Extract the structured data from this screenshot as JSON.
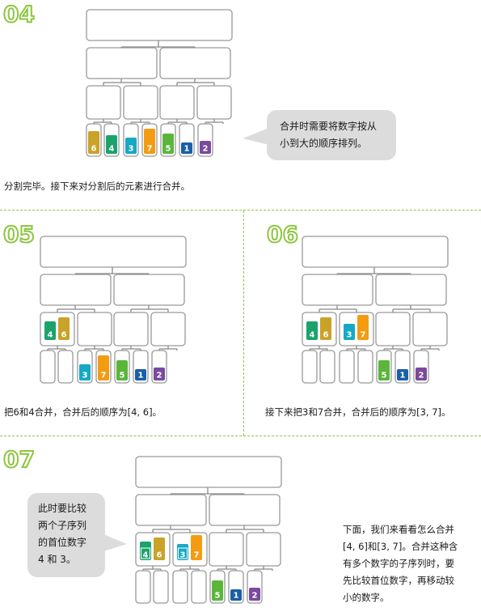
{
  "colors": {
    "accent_green": "#8dc63f",
    "box_border": "#999999",
    "connector": "#888888",
    "bubble_bg": "#dcdcdc",
    "digit_colors": {
      "1": "#1a5fa8",
      "2": "#7a4a9e",
      "3": "#16a9c4",
      "4": "#1aa36b",
      "5": "#5cb53b",
      "6": "#c9a227",
      "7": "#f39c12"
    }
  },
  "steps": [
    {
      "number": "04",
      "slots": [
        [
          "6"
        ],
        [
          "4"
        ],
        [
          "3"
        ],
        [
          "7"
        ],
        [
          "5"
        ],
        [
          "1"
        ],
        [
          "2"
        ]
      ],
      "pairs": [
        [],
        [],
        [],
        []
      ],
      "quads": [
        [],
        []
      ],
      "highlight": [],
      "bubble_lines": [
        "合并时需要将数字按从",
        "小到大的顺序排列。"
      ],
      "caption": "分割完毕。接下来对分割后的元素进行合并。"
    },
    {
      "number": "05",
      "slots": [
        [],
        [],
        [
          "3"
        ],
        [
          "7"
        ],
        [
          "5"
        ],
        [
          "1"
        ],
        [
          "2"
        ]
      ],
      "pairs": [
        [
          "4",
          "6"
        ],
        [],
        [],
        []
      ],
      "quads": [
        [],
        []
      ],
      "highlight": [],
      "caption": "把6和4合并，合并后的顺序为[4, 6]。"
    },
    {
      "number": "06",
      "slots": [
        [],
        [],
        [],
        [],
        [
          "5"
        ],
        [
          "1"
        ],
        [
          "2"
        ]
      ],
      "pairs": [
        [
          "4",
          "6"
        ],
        [
          "3",
          "7"
        ],
        [],
        []
      ],
      "quads": [
        [],
        []
      ],
      "highlight": [],
      "caption": "接下来把3和7合并，合并后的顺序为[3, 7]。"
    },
    {
      "number": "07",
      "slots": [
        [],
        [],
        [],
        [],
        [
          "5"
        ],
        [
          "1"
        ],
        [
          "2"
        ]
      ],
      "pairs": [
        [
          "4",
          "6"
        ],
        [
          "3",
          "7"
        ],
        [],
        []
      ],
      "quads": [
        [],
        []
      ],
      "highlight": [
        "4",
        "3"
      ],
      "bubble_lines": [
        "此时要比较",
        "两个子序列",
        "的首位数字",
        "4 和 3。"
      ],
      "paragraph_lines": [
        "下面，我们来看看怎么合并",
        "[4, 6]和[3, 7]。合并这种含",
        "有多个数字的子序列时，要",
        "先比较首位数字，再移动较",
        "小的数字。"
      ]
    }
  ]
}
